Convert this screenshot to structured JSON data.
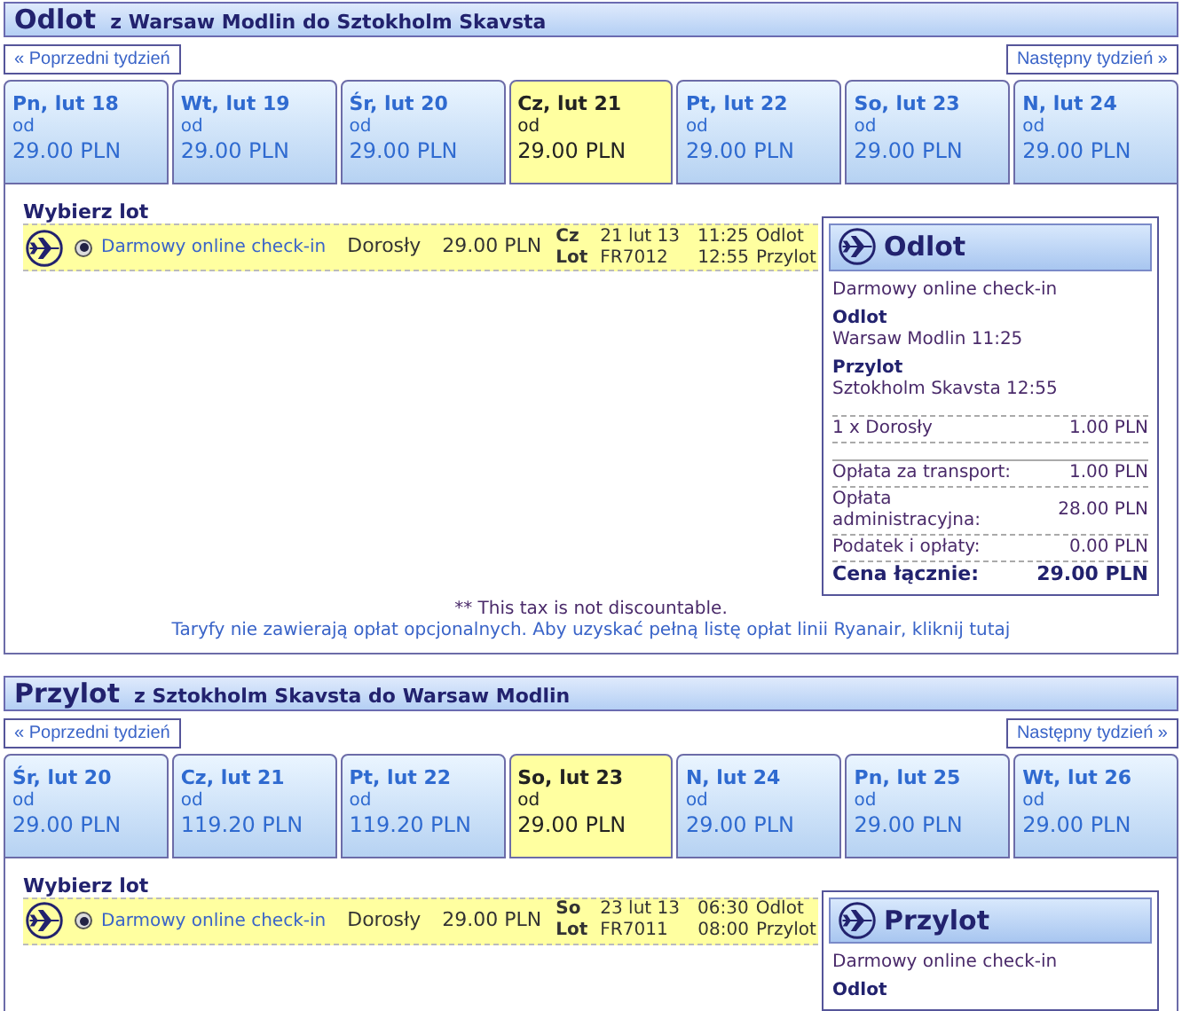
{
  "sections": [
    {
      "title": "Odlot",
      "route": "z Warsaw Modlin do Sztokholm Skavsta",
      "prev": "« Poprzedni tydzień",
      "next": "Następny tydzień »",
      "days": [
        {
          "label": "Pn, lut 18",
          "from": "od",
          "price": "29.00 PLN",
          "selected": false
        },
        {
          "label": "Wt, lut 19",
          "from": "od",
          "price": "29.00 PLN",
          "selected": false
        },
        {
          "label": "Śr, lut 20",
          "from": "od",
          "price": "29.00 PLN",
          "selected": false
        },
        {
          "label": "Cz, lut 21",
          "from": "od",
          "price": "29.00 PLN",
          "selected": true
        },
        {
          "label": "Pt, lut 22",
          "from": "od",
          "price": "29.00 PLN",
          "selected": false
        },
        {
          "label": "So, lut 23",
          "from": "od",
          "price": "29.00 PLN",
          "selected": false
        },
        {
          "label": "N, lut 24",
          "from": "od",
          "price": "29.00 PLN",
          "selected": false
        }
      ],
      "choose": "Wybierz lot",
      "flight": {
        "selected": true,
        "fare": "Darmowy online check-in",
        "passenger": "Dorosły",
        "price": "29.00 PLN",
        "day": "Cz",
        "date": "21 lut 13",
        "dep_time": "11:25",
        "dep_label": "Odlot",
        "flight_label": "Lot",
        "number": "FR7012",
        "arr_time": "12:55",
        "arr_label": "Przylot"
      },
      "summary": {
        "title": "Odlot",
        "fare": "Darmowy online check-in",
        "legs": [
          {
            "label": "Odlot",
            "value": "Warsaw Modlin 11:25"
          },
          {
            "label": "Przylot",
            "value": "Sztokholm Skavsta 12:55"
          }
        ],
        "lines": [
          {
            "kind": "item",
            "label": "1 x Dorosły",
            "value": "1.00 PLN"
          },
          {
            "kind": "spacer"
          },
          {
            "kind": "item",
            "label": "Opłata za transport:",
            "value": "1.00 PLN"
          },
          {
            "kind": "item",
            "label": "Opłata administracyjna:",
            "value": "28.00 PLN"
          },
          {
            "kind": "item",
            "label": "Podatek i opłaty:",
            "value": "0.00 PLN"
          },
          {
            "kind": "total",
            "label": "Cena łącznie:",
            "value": "29.00 PLN"
          }
        ]
      },
      "note": "** This tax is not discountable.",
      "link": "Taryfy nie zawierają opłat opcjonalnych. Aby uzyskać pełną listę opłat linii Ryanair, kliknij tutaj"
    },
    {
      "title": "Przylot",
      "route": "z Sztokholm Skavsta do Warsaw Modlin",
      "prev": "« Poprzedni tydzień",
      "next": "Następny tydzień »",
      "days": [
        {
          "label": "Śr, lut 20",
          "from": "od",
          "price": "29.00 PLN",
          "selected": false
        },
        {
          "label": "Cz, lut 21",
          "from": "od",
          "price": "119.20 PLN",
          "selected": false
        },
        {
          "label": "Pt, lut 22",
          "from": "od",
          "price": "119.20 PLN",
          "selected": false
        },
        {
          "label": "So, lut 23",
          "from": "od",
          "price": "29.00 PLN",
          "selected": true
        },
        {
          "label": "N, lut 24",
          "from": "od",
          "price": "29.00 PLN",
          "selected": false
        },
        {
          "label": "Pn, lut 25",
          "from": "od",
          "price": "29.00 PLN",
          "selected": false
        },
        {
          "label": "Wt, lut 26",
          "from": "od",
          "price": "29.00 PLN",
          "selected": false
        }
      ],
      "choose": "Wybierz lot",
      "flight": {
        "selected": true,
        "fare": "Darmowy online check-in",
        "passenger": "Dorosły",
        "price": "29.00 PLN",
        "day": "So",
        "date": "23 lut 13",
        "dep_time": "06:30",
        "dep_label": "Odlot",
        "flight_label": "Lot",
        "number": "FR7011",
        "arr_time": "08:00",
        "arr_label": "Przylot"
      },
      "summary": {
        "title": "Przylot",
        "fare": "Darmowy online check-in",
        "legs": [
          {
            "label": "Odlot"
          }
        ]
      }
    }
  ]
}
